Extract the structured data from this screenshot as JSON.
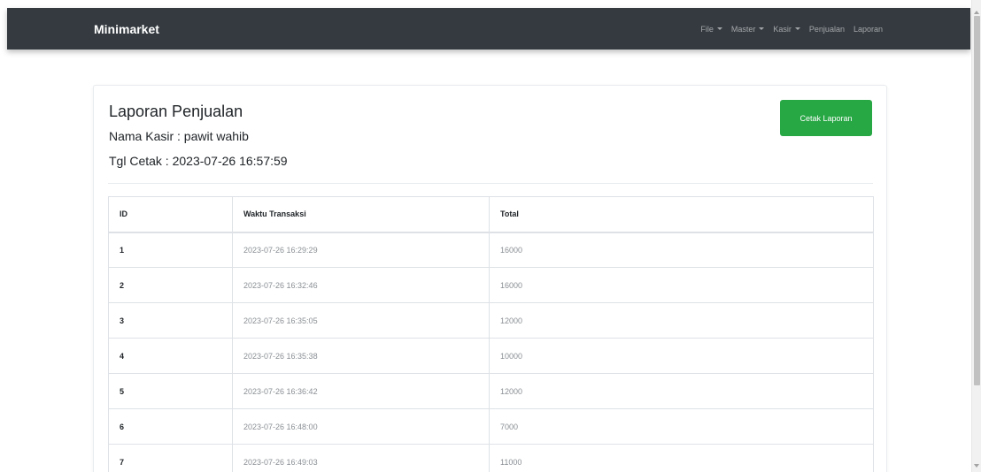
{
  "navbar": {
    "brand": "Minimarket",
    "menu": [
      {
        "label": "File",
        "dropdown": true
      },
      {
        "label": "Master",
        "dropdown": true
      },
      {
        "label": "Kasir",
        "dropdown": true
      },
      {
        "label": "Penjualan",
        "dropdown": false
      },
      {
        "label": "Laporan",
        "dropdown": false
      }
    ]
  },
  "report": {
    "title": "Laporan Penjualan",
    "cashier": "Nama Kasir : pawit wahib",
    "print_date": "Tgl Cetak : 2023-07-26 16:57:59",
    "print_button": "Cetak Laporan"
  },
  "table": {
    "headers": [
      "ID",
      "Waktu Transaksi",
      "Total"
    ],
    "rows": [
      [
        "1",
        "2023-07-26 16:29:29",
        "16000"
      ],
      [
        "2",
        "2023-07-26 16:32:46",
        "16000"
      ],
      [
        "3",
        "2023-07-26 16:35:05",
        "12000"
      ],
      [
        "4",
        "2023-07-26 16:35:38",
        "10000"
      ],
      [
        "5",
        "2023-07-26 16:36:42",
        "12000"
      ],
      [
        "6",
        "2023-07-26 16:48:00",
        "7000"
      ],
      [
        "7",
        "2023-07-26 16:49:03",
        "11000"
      ]
    ]
  },
  "colors": {
    "navbar_bg": "#343a40",
    "button_success": "#28a745"
  }
}
